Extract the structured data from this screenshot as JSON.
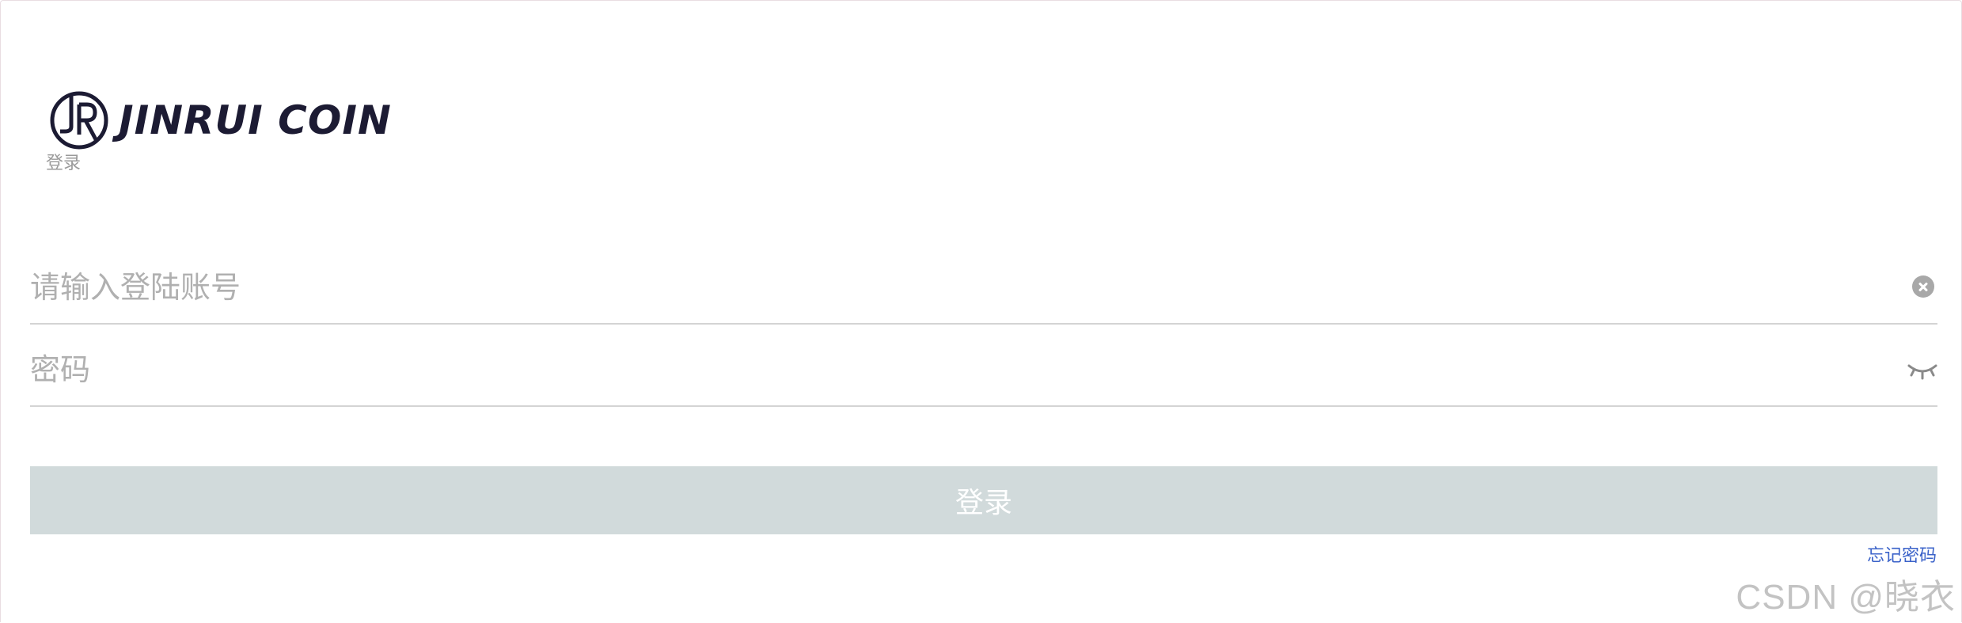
{
  "brand": {
    "name": "JINRUI COIN",
    "logo_icon": "jr-circle-logo",
    "color": "#1c1b33"
  },
  "page": {
    "subtitle": "登录"
  },
  "form": {
    "account": {
      "placeholder": "请输入登陆账号",
      "value": "",
      "trailing_icon": "clear-icon"
    },
    "password": {
      "placeholder": "密码",
      "value": "",
      "trailing_icon": "eye-closed-icon"
    },
    "submit_label": "登录",
    "submit_color": "#d1dadb",
    "forgot_label": "忘记密码",
    "link_color": "#3a62c9"
  },
  "watermark": "CSDN @晓衣"
}
